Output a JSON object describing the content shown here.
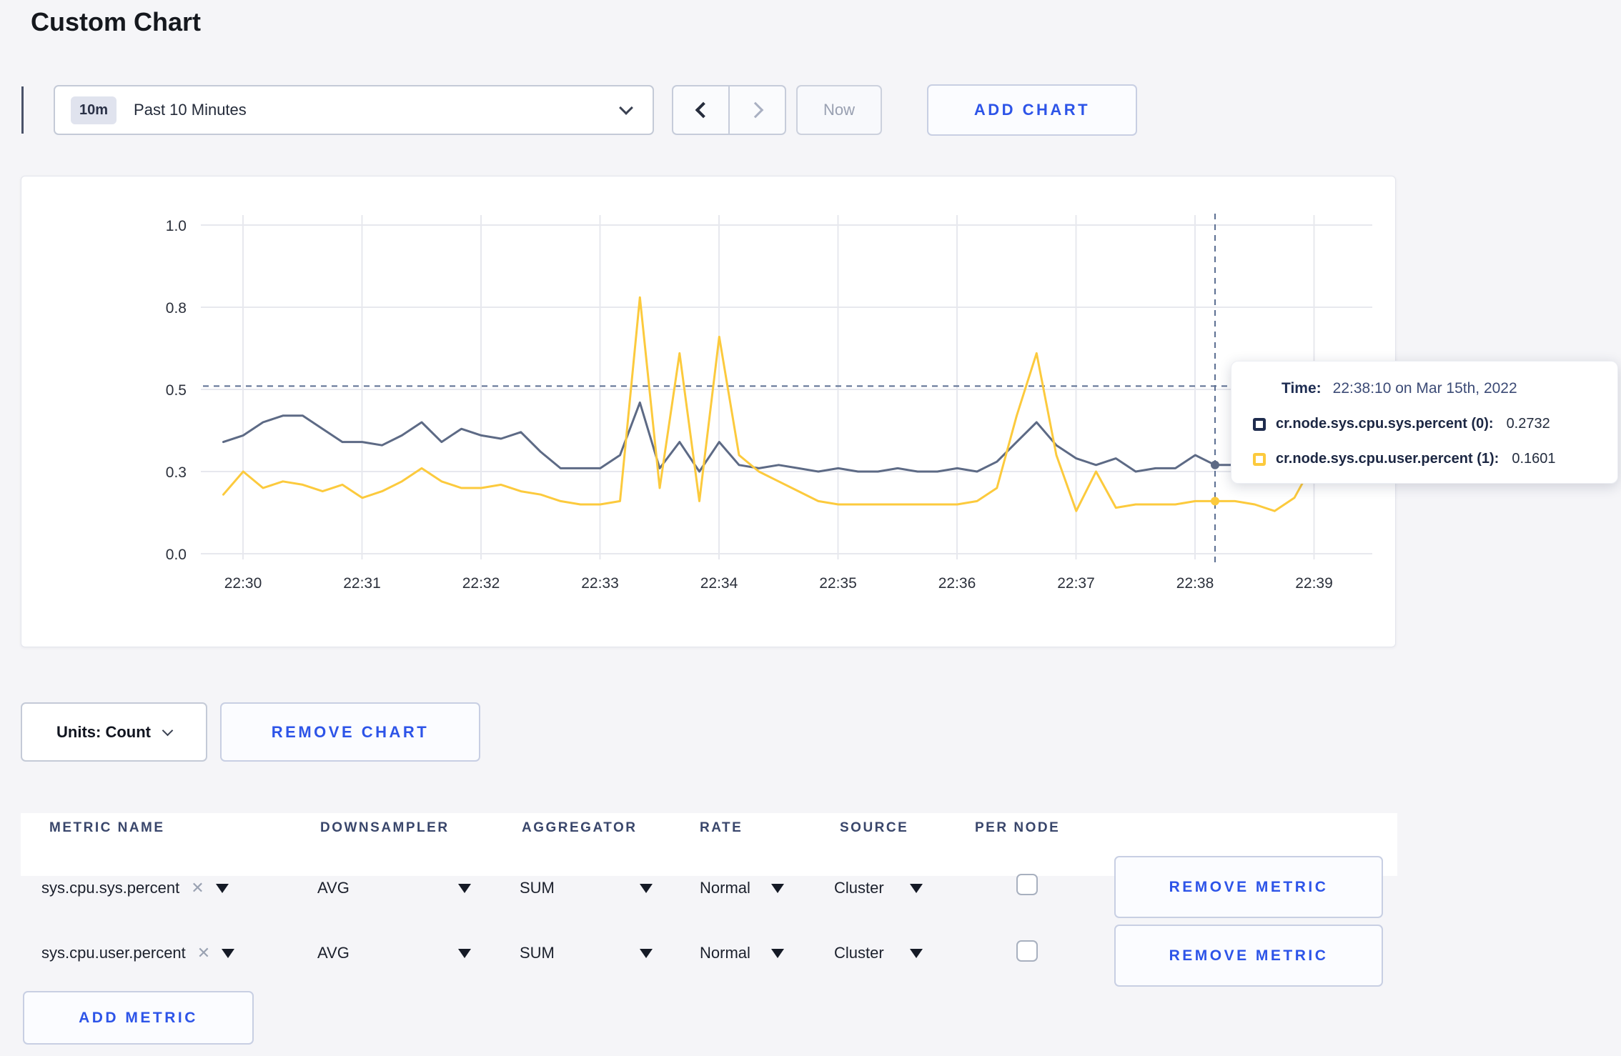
{
  "page": {
    "title": "Custom Chart"
  },
  "toolbar": {
    "time_range_badge": "10m",
    "time_range_label": "Past 10 Minutes",
    "now_label": "Now",
    "add_chart_label": "ADD CHART"
  },
  "icons": {
    "close": "✕"
  },
  "colors": {
    "accent_blue": "#2d54e8",
    "series_sys": "#5d6a85",
    "series_user": "#fcca3d",
    "gridline": "#e7e8ee",
    "crosshair": "#5c6f92"
  },
  "chart_data": {
    "type": "line",
    "title": "",
    "xlabel": "",
    "ylabel": "",
    "ylim": [
      0,
      1
    ],
    "x_start": "22:29:50",
    "x_step_seconds": 10,
    "x_tick_labels": [
      "22:30",
      "22:31",
      "22:32",
      "22:33",
      "22:34",
      "22:35",
      "22:36",
      "22:37",
      "22:38",
      "22:39"
    ],
    "y_ticks": [
      {
        "label": "0.0",
        "value": 0
      },
      {
        "label": "0.3",
        "value": 0.25
      },
      {
        "label": "0.5",
        "value": 0.5
      },
      {
        "label": "0.8",
        "value": 0.75
      },
      {
        "label": "1.0",
        "value": 1
      }
    ],
    "legend_position": "tooltip",
    "grid": true,
    "series": [
      {
        "name": "cr.node.sys.cpu.sys.percent",
        "color": "#5d6a85",
        "values": [
          0.34,
          0.36,
          0.4,
          0.42,
          0.42,
          0.38,
          0.34,
          0.34,
          0.33,
          0.36,
          0.4,
          0.34,
          0.38,
          0.36,
          0.35,
          0.37,
          0.31,
          0.26,
          0.26,
          0.26,
          0.3,
          0.46,
          0.26,
          0.34,
          0.25,
          0.34,
          0.27,
          0.26,
          0.27,
          0.26,
          0.25,
          0.26,
          0.25,
          0.25,
          0.26,
          0.25,
          0.25,
          0.26,
          0.25,
          0.28,
          0.34,
          0.4,
          0.33,
          0.29,
          0.27,
          0.29,
          0.25,
          0.26,
          0.26,
          0.3,
          0.27,
          0.27,
          0.29,
          0.3,
          0.28,
          0.29,
          0.31
        ]
      },
      {
        "name": "cr.node.sys.cpu.user.percent",
        "color": "#fcca3d",
        "values": [
          0.18,
          0.25,
          0.2,
          0.22,
          0.21,
          0.19,
          0.21,
          0.17,
          0.19,
          0.22,
          0.26,
          0.22,
          0.2,
          0.2,
          0.21,
          0.19,
          0.18,
          0.16,
          0.15,
          0.15,
          0.16,
          0.78,
          0.2,
          0.61,
          0.16,
          0.66,
          0.3,
          0.25,
          0.22,
          0.19,
          0.16,
          0.15,
          0.15,
          0.15,
          0.15,
          0.15,
          0.15,
          0.15,
          0.16,
          0.2,
          0.42,
          0.61,
          0.3,
          0.13,
          0.25,
          0.14,
          0.15,
          0.15,
          0.15,
          0.16,
          0.16,
          0.16,
          0.15,
          0.13,
          0.17,
          0.28,
          0.24
        ]
      }
    ],
    "crosshair": {
      "x_index": 50,
      "x_time": "22:38:10",
      "y_value": 0.51,
      "sys_value": 0.2732,
      "user_value": 0.1601
    }
  },
  "tooltip": {
    "time_label": "Time:",
    "time_value": "22:38:10 on Mar 15th, 2022",
    "series": [
      {
        "name": "cr.node.sys.cpu.sys.percent (0):",
        "value": "0.2732"
      },
      {
        "name": "cr.node.sys.cpu.user.percent (1):",
        "value": "0.1601"
      }
    ]
  },
  "chart_controls": {
    "units_label": "Units: Count",
    "remove_chart_label": "REMOVE CHART"
  },
  "metrics_table": {
    "headers": [
      "METRIC NAME",
      "DOWNSAMPLER",
      "AGGREGATOR",
      "RATE",
      "SOURCE",
      "PER NODE"
    ],
    "rows": [
      {
        "metric": "sys.cpu.sys.percent",
        "downsampler": "AVG",
        "aggregator": "SUM",
        "rate": "Normal",
        "source": "Cluster",
        "per_node_checked": false,
        "remove_label": "REMOVE METRIC"
      },
      {
        "metric": "sys.cpu.user.percent",
        "downsampler": "AVG",
        "aggregator": "SUM",
        "rate": "Normal",
        "source": "Cluster",
        "per_node_checked": false,
        "remove_label": "REMOVE METRIC"
      }
    ],
    "add_metric_label": "ADD METRIC"
  }
}
